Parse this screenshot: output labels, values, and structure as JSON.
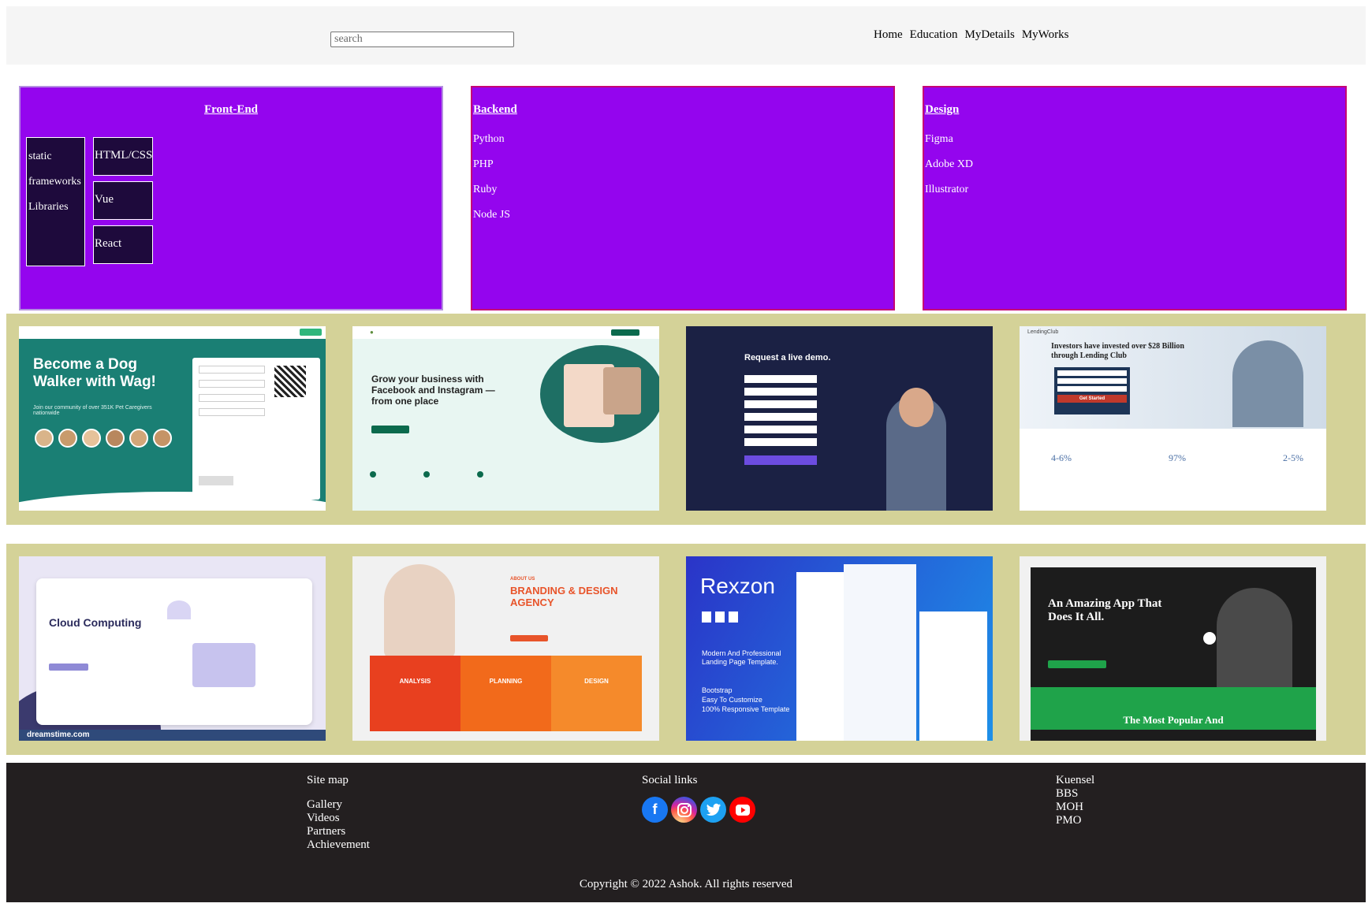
{
  "header": {
    "search_placeholder": "search",
    "nav": [
      "Home",
      "Education",
      "MyDetails",
      "MyWorks"
    ]
  },
  "categories": {
    "frontend": {
      "title": "Front-End",
      "left": [
        "static",
        "frameworks",
        "Libraries"
      ],
      "right": [
        "HTML/CSS",
        "Vue",
        "React"
      ]
    },
    "backend": {
      "title": "Backend",
      "items": [
        "Python",
        "PHP",
        "Ruby",
        "Node JS"
      ]
    },
    "design": {
      "title": "Design",
      "items": [
        "Figma",
        "Adobe XD",
        "Illustrator"
      ]
    }
  },
  "gallery": {
    "row1": [
      {
        "headline": "Become a Dog Walker with Wag!",
        "sub": "Join our community of over 351K Pet Caregivers nationwide",
        "bg": "#1a7f74"
      },
      {
        "headline": "Grow your business with Facebook and Instagram — from one place",
        "bg": "#e8f6f2"
      },
      {
        "headline": "Request a live demo.",
        "bg": "#1b2144"
      },
      {
        "headline": "Investors have invested over $28 Billion through Lending Club",
        "button": "Get Started",
        "stats": [
          "4-6%",
          "97%",
          "2-5%"
        ],
        "bg": "#ffffff"
      }
    ],
    "row2": [
      {
        "headline": "Cloud Computing",
        "watermark": "dreamstime.com",
        "bg": "#e9e6f5"
      },
      {
        "headline": "BRANDING & DESIGN AGENCY",
        "tag": "ABOUT US",
        "panels": [
          "ANALYSIS",
          "PLANNING",
          "DESIGN"
        ],
        "bg": "#f1f1f1"
      },
      {
        "headline": "Rexzon",
        "sub": "Modern And Professional Landing Page Template.",
        "features": [
          "Bootstrap",
          "Easy To Customize",
          "100% Responsive Template"
        ],
        "bg": "#2a34c8"
      },
      {
        "headline": "An Amazing App That Does It All.",
        "footer": "The Most Popular And",
        "bg": "#1c1c1c"
      }
    ]
  },
  "footer": {
    "sitemap": {
      "title": "Site map",
      "links": [
        "Gallery",
        "Videos",
        "Partners",
        "Achievement"
      ]
    },
    "social": {
      "title": "Social links",
      "icons": [
        "facebook-icon",
        "instagram-icon",
        "twitter-icon",
        "youtube-icon"
      ]
    },
    "others": [
      "Kuensel",
      "BBS",
      "MOH",
      "PMO"
    ],
    "copyright": "Copyright © 2022 Ashok. All rights reserved"
  }
}
